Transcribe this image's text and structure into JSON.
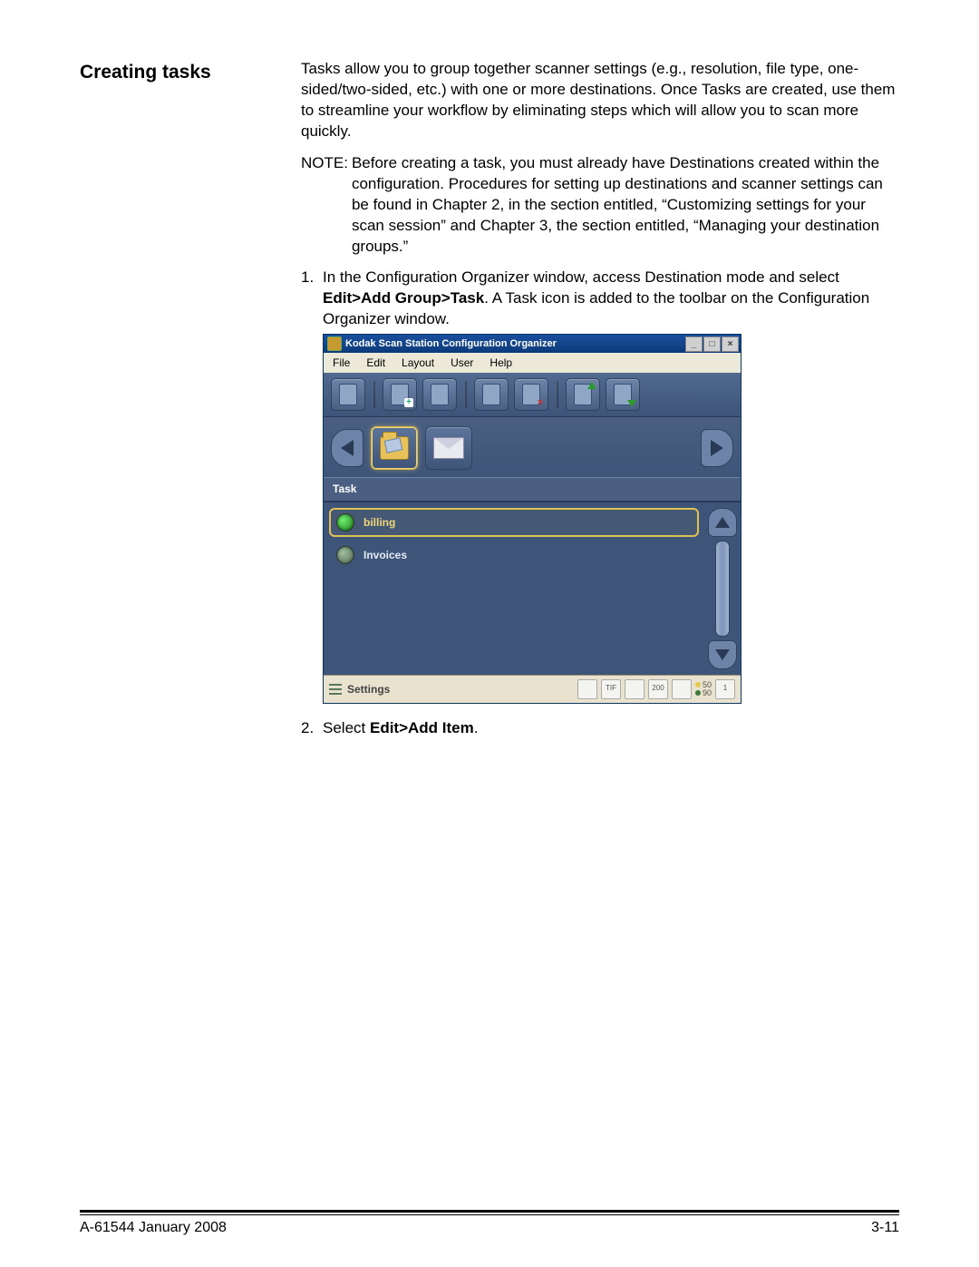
{
  "heading": "Creating tasks",
  "intro": "Tasks allow you to group together scanner settings (e.g., resolution, file type, one-sided/two-sided, etc.) with one or more destinations. Once Tasks are created, use them to streamline your workflow by eliminating steps which will allow you to scan more quickly.",
  "note_label": "NOTE:",
  "note_body": "Before creating a task, you must already have Destinations created within the configuration. Procedures for setting up destinations and scanner settings can be found in Chapter 2, in the section entitled, “Customizing settings for your scan session” and Chapter 3, the section entitled, “Managing your destination groups.”",
  "step1_num": "1.",
  "step1_a": "In the Configuration Organizer window, access Destination mode and select ",
  "step1_bold": "Edit>Add Group>Task",
  "step1_b": ". A Task icon is added to the toolbar on the Configuration Organizer window.",
  "step2_num": "2.",
  "step2_a": "Select ",
  "step2_bold": "Edit>Add Item",
  "step2_b": ".",
  "app": {
    "title": "Kodak Scan Station Configuration Organizer",
    "menu": {
      "file": "File",
      "edit": "Edit",
      "layout": "Layout",
      "user": "User",
      "help": "Help"
    },
    "section_label": "Task",
    "items": {
      "billing": "billing",
      "invoices": "Invoices"
    },
    "status_label": "Settings",
    "sb": {
      "tif": "TIF",
      "dpi": "200",
      "q_top": "50",
      "q_bot": "90",
      "pages": "1"
    }
  },
  "footer": {
    "left": "A-61544  January 2008",
    "right": "3-11"
  }
}
